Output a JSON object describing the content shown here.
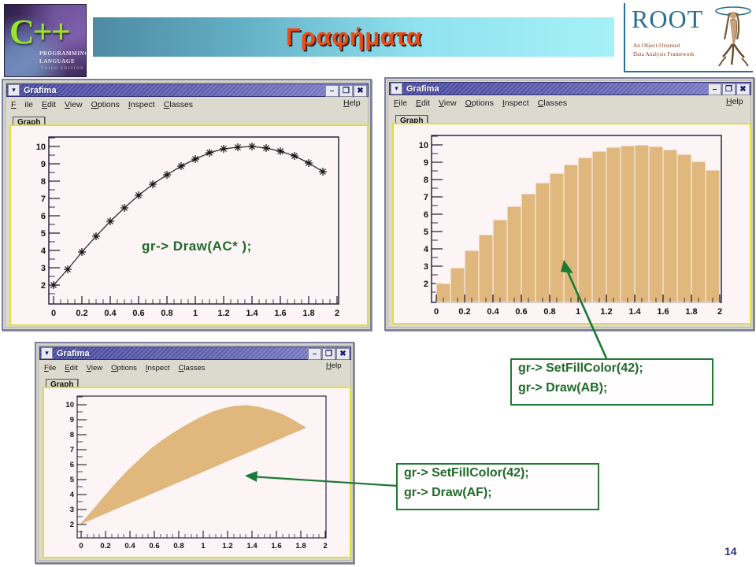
{
  "slide": {
    "title": "Γραφήματα",
    "page_number": "14",
    "title_color": "#f04a14",
    "band_color": "#63aec4"
  },
  "cpp_book": {
    "glyph": "C++",
    "line1": "PROGRAMMING",
    "line2": "LANGUAGE",
    "line3": "THIRD EDITION"
  },
  "root_logo": {
    "word": "ROOT",
    "tagline1": "An Object-Oriented",
    "tagline2": "Data Analysis Framework",
    "color": "#2a6f93"
  },
  "window_common": {
    "title": "Grafima",
    "menu": [
      {
        "label": "File",
        "accel": "F"
      },
      {
        "label": "Edit",
        "accel": "E"
      },
      {
        "label": "View",
        "accel": "V"
      },
      {
        "label": "Options",
        "accel": "O"
      },
      {
        "label": "Inspect",
        "accel": "I"
      },
      {
        "label": "Classes",
        "accel": "C"
      }
    ],
    "help_label": "Help",
    "tab_label": "Graph",
    "buttons": {
      "menu_icon": "menu-chevron-icon",
      "minimize": "–",
      "maximize": "❐",
      "close": "✖"
    }
  },
  "windows": [
    {
      "id": "win-scatter",
      "title": "Grafima",
      "tab_label": "Graph",
      "annotation": "gr-> Draw(AC* );"
    },
    {
      "id": "win-bar",
      "title": "Grafima",
      "tab_label": "Graph",
      "annotation_line1": "gr-> SetFillColor(42);",
      "annotation_line2": "gr-> Draw(AB);"
    },
    {
      "id": "win-fill",
      "title": "Grafima",
      "tab_label": "Graph",
      "annotation_line1": "gr-> SetFillColor(42);",
      "annotation_line2": "gr-> Draw(AF);"
    }
  ],
  "chart_data": [
    {
      "type": "scatter",
      "id": "scatter-curve",
      "title": "",
      "xlabel": "",
      "ylabel": "",
      "xlim": [
        -0.08,
        2.1
      ],
      "ylim": [
        1.6,
        10.6
      ],
      "xticks": [
        "0",
        "0.2",
        "0.4",
        "0.6",
        "0.8",
        "1",
        "1.2",
        "1.4",
        "1.6",
        "1.8",
        "2"
      ],
      "yticks": [
        "2",
        "3",
        "4",
        "5",
        "6",
        "7",
        "8",
        "9",
        "10"
      ],
      "grid": false,
      "legend": "none",
      "marker": "star",
      "line_color": "#333333",
      "x": [
        0,
        0.1,
        0.2,
        0.3,
        0.4,
        0.5,
        0.6,
        0.7,
        0.8,
        0.9,
        1.0,
        1.1,
        1.2,
        1.3,
        1.4,
        1.5,
        1.6,
        1.7,
        1.8,
        1.9
      ],
      "y": [
        2.0,
        2.9,
        3.9,
        4.8,
        5.65,
        6.45,
        7.2,
        7.85,
        8.4,
        8.9,
        9.3,
        9.65,
        9.9,
        10.0,
        10.02,
        9.95,
        9.75,
        9.5,
        9.1,
        8.6
      ]
    },
    {
      "type": "bar",
      "id": "bar-hist",
      "title": "",
      "xlabel": "",
      "ylabel": "",
      "xlim": [
        -0.08,
        2.1
      ],
      "ylim": [
        1.6,
        10.6
      ],
      "xticks": [
        "0",
        "0.2",
        "0.4",
        "0.6",
        "0.8",
        "1",
        "1.2",
        "1.4",
        "1.6",
        "1.8",
        "2"
      ],
      "yticks": [
        "2",
        "3",
        "4",
        "5",
        "6",
        "7",
        "8",
        "9",
        "10"
      ],
      "grid": false,
      "legend": "none",
      "fill_color": "#e0b87e",
      "categories": [
        0,
        0.1,
        0.2,
        0.3,
        0.4,
        0.5,
        0.6,
        0.7,
        0.8,
        0.9,
        1.0,
        1.1,
        1.2,
        1.3,
        1.4,
        1.5,
        1.6,
        1.7,
        1.8,
        1.9
      ],
      "values": [
        2.0,
        2.9,
        3.9,
        4.8,
        5.65,
        6.45,
        7.2,
        7.85,
        8.4,
        8.9,
        9.3,
        9.65,
        9.9,
        10.0,
        10.02,
        9.95,
        9.75,
        9.5,
        9.1,
        8.6
      ]
    },
    {
      "type": "area",
      "id": "fill-area",
      "title": "",
      "xlabel": "",
      "ylabel": "",
      "xlim": [
        -0.08,
        2.1
      ],
      "ylim": [
        1.6,
        10.6
      ],
      "xticks": [
        "0",
        "0.2",
        "0.4",
        "0.6",
        "0.8",
        "1",
        "1.2",
        "1.4",
        "1.6",
        "1.8",
        "2"
      ],
      "yticks": [
        "2",
        "3",
        "4",
        "5",
        "6",
        "7",
        "8",
        "9",
        "10"
      ],
      "grid": false,
      "legend": "none",
      "fill_color": "#e0b87e",
      "x": [
        0,
        0.1,
        0.2,
        0.3,
        0.4,
        0.5,
        0.6,
        0.7,
        0.8,
        0.9,
        1.0,
        1.1,
        1.2,
        1.3,
        1.4,
        1.5,
        1.6,
        1.7,
        1.8,
        1.9
      ],
      "y": [
        2.0,
        2.9,
        3.9,
        4.8,
        5.65,
        6.45,
        7.2,
        7.85,
        8.4,
        8.9,
        9.3,
        9.65,
        9.9,
        10.0,
        10.02,
        9.95,
        9.75,
        9.5,
        9.1,
        8.6
      ],
      "baseline_note": "closed polygon back to first point"
    }
  ]
}
